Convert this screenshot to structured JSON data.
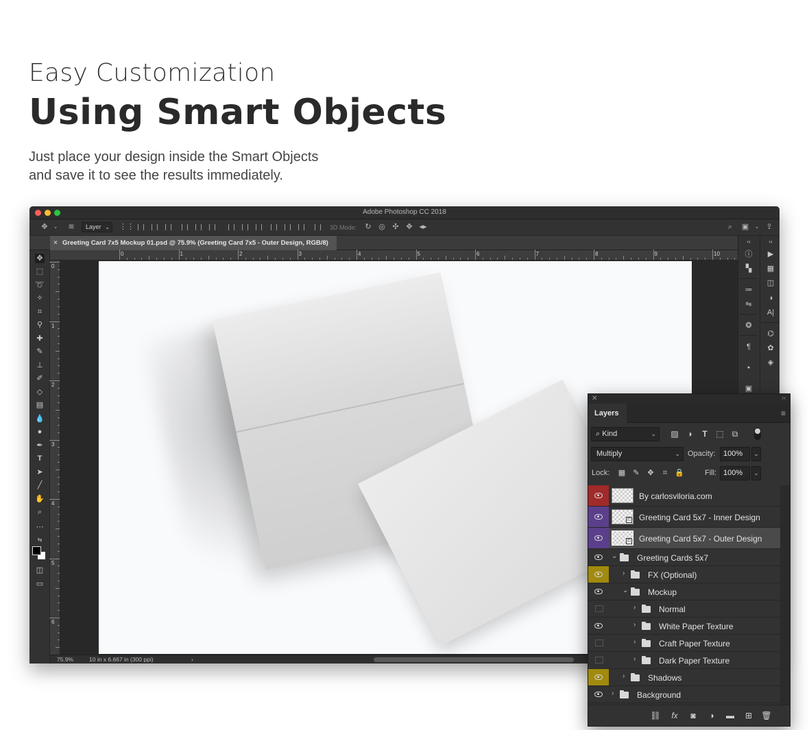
{
  "hero": {
    "kicker": "Easy Customization",
    "title": "Using Smart Objects",
    "desc_line1": "Just place your design inside the Smart Objects",
    "desc_line2": "and save it to see the results immediately."
  },
  "window": {
    "app_title": "Adobe Photoshop CC 2018",
    "traffic_colors": [
      "#fc5f57",
      "#fdbc2e",
      "#29c840"
    ]
  },
  "options_bar": {
    "auto_select_value": "Layer",
    "three_d_label": "3D Mode:"
  },
  "document": {
    "tab_title": "Greeting Card 7x5 Mockup 01.psd @ 75.9% (Greeting Card 7x5 - Outer Design, RGB/8)",
    "tab_close": "×"
  },
  "rulers": {
    "top_labels": [
      "0",
      "1",
      "2",
      "3",
      "4",
      "5",
      "6",
      "7",
      "8",
      "9",
      "10"
    ],
    "left_labels": [
      "0",
      "1",
      "2",
      "3",
      "4",
      "5",
      "6"
    ]
  },
  "status": {
    "zoom": "75.9%",
    "doc_info": "10 in x 6.667 in (300 ppi)",
    "arrow": "›"
  },
  "layers_panel": {
    "tab_label": "Layers",
    "filter_kind": "Kind",
    "blend_mode": "Multiply",
    "opacity_label": "Opacity:",
    "opacity_value": "100%",
    "lock_label": "Lock:",
    "fill_label": "Fill:",
    "fill_value": "100%",
    "layers": [
      {
        "name": "By carlosviloria.com",
        "type": "layer",
        "eye_color": "#a12a2a",
        "visible": true
      },
      {
        "name": "Greeting Card 5x7 - Inner Design",
        "type": "smart",
        "eye_color": "#5b3f8c",
        "visible": true
      },
      {
        "name": "Greeting Card 5x7 - Outer Design",
        "type": "smart",
        "eye_color": "#5b3f8c",
        "visible": true,
        "selected": true
      },
      {
        "name": "Greeting Cards 5x7",
        "type": "group",
        "expanded": true,
        "visible": true
      },
      {
        "name": "FX (Optional)",
        "type": "group",
        "eye_color": "#a18a0e",
        "visible": true
      },
      {
        "name": "Mockup",
        "type": "group",
        "expanded": true,
        "visible": true
      },
      {
        "name": "Normal",
        "type": "group",
        "visible": false
      },
      {
        "name": "White Paper Texture",
        "type": "group",
        "visible": true
      },
      {
        "name": "Craft Paper Texture",
        "type": "group",
        "visible": false
      },
      {
        "name": "Dark Paper Texture",
        "type": "group",
        "visible": false
      },
      {
        "name": "Shadows",
        "type": "group",
        "eye_color": "#a18a0e",
        "visible": true
      },
      {
        "name": "Background",
        "type": "group",
        "visible": true
      }
    ]
  }
}
